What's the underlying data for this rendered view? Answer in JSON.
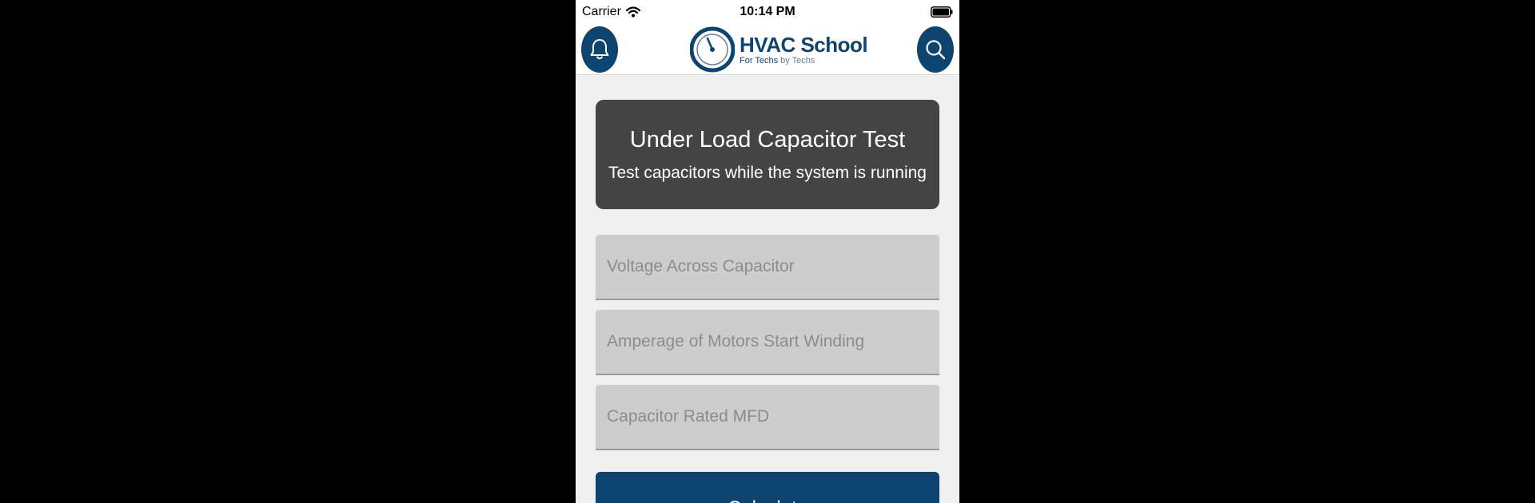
{
  "status_bar": {
    "carrier": "Carrier",
    "time": "10:14 PM"
  },
  "header": {
    "logo_title": "HVAC School",
    "logo_tag_bold": "For Techs",
    "logo_tag_light": "by Techs",
    "left_icon": "bell-icon",
    "right_icon": "search-icon"
  },
  "card": {
    "title": "Under Load Capacitor Test",
    "subtitle": "Test capacitors while the system is running"
  },
  "fields": {
    "voltage": {
      "placeholder": "Voltage Across Capacitor",
      "value": ""
    },
    "amperage": {
      "placeholder": "Amperage of Motors Start Winding",
      "value": ""
    },
    "mfd": {
      "placeholder": "Capacitor Rated MFD",
      "value": ""
    }
  },
  "actions": {
    "calculate_label": "Calculate"
  },
  "colors": {
    "brand": "#0d4470",
    "card": "#444444",
    "field": "#cdcdcd",
    "background": "#f0f0f0"
  }
}
